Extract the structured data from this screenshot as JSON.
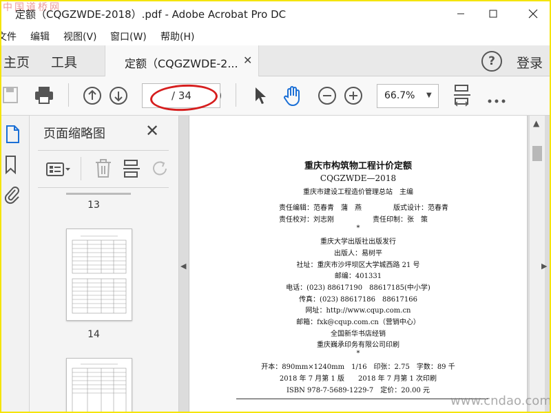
{
  "watermark_top": "中国道桥网",
  "watermark_bottom": "www.cndao.com",
  "window": {
    "title": "定额（CQGZWDE-2018）.pdf - Adobe Acrobat Pro DC",
    "minimize_icon": "minimize-icon",
    "maximize_icon": "maximize-icon",
    "close_icon": "close-icon"
  },
  "menu": {
    "items": [
      "文件",
      "编辑",
      "视图(V)",
      "窗口(W)",
      "帮助(H)"
    ]
  },
  "tabs": {
    "home": "主页",
    "tools": "工具",
    "document": "定额（CQGZWDE-2...",
    "help": "?",
    "login": "登录"
  },
  "toolbar": {
    "page_current": "",
    "page_total": "/ 34",
    "zoom": "66.7%"
  },
  "colors": {
    "accent_blue": "#1a6fd6",
    "annotation_red": "#d61e1e",
    "border_yellow": "#f5e400"
  },
  "panel": {
    "title": "页面缩略图",
    "thumbnails": [
      {
        "label": "13"
      },
      {
        "label": "14"
      }
    ]
  },
  "page": {
    "title": "重庆市构筑物工程计价定额",
    "code": "CQGZWDE—2018",
    "editor_org": "重庆市建设工程造价管理总站　主编",
    "row1_left": "责任编辑：范春青　蒲　燕",
    "row1_right": "版式设计：范春青",
    "row2_left": "责任校对：刘志刚",
    "row2_right": "责任印制：张　策",
    "star1": "*",
    "publisher": "重庆大学出版社出版发行",
    "publisher_person": "出版人：易树平",
    "address": "社址：重庆市沙坪坝区大学城西路 21 号",
    "postcode": "邮编：401331",
    "phone": "电话：(023) 88617190　88617185(中小学)",
    "fax": "传真：(023) 88617186　88617166",
    "website": "网址：http://www.cqup.com.cn",
    "email": "邮箱：fxk@cqup.com.cn（营销中心）",
    "distributor": "全国新华书店经销",
    "printer": "重庆巍承印务有限公司印刷",
    "star2": "*",
    "format": "开本：890mm×1240mm　1/16　印张：2.75　字数：89 千",
    "edition": "2018 年 7 月第 1 版　　2018 年 7 月第 1 次印刷",
    "isbn": "ISBN 978-7-5689-1229-7　定价：20.00 元"
  }
}
